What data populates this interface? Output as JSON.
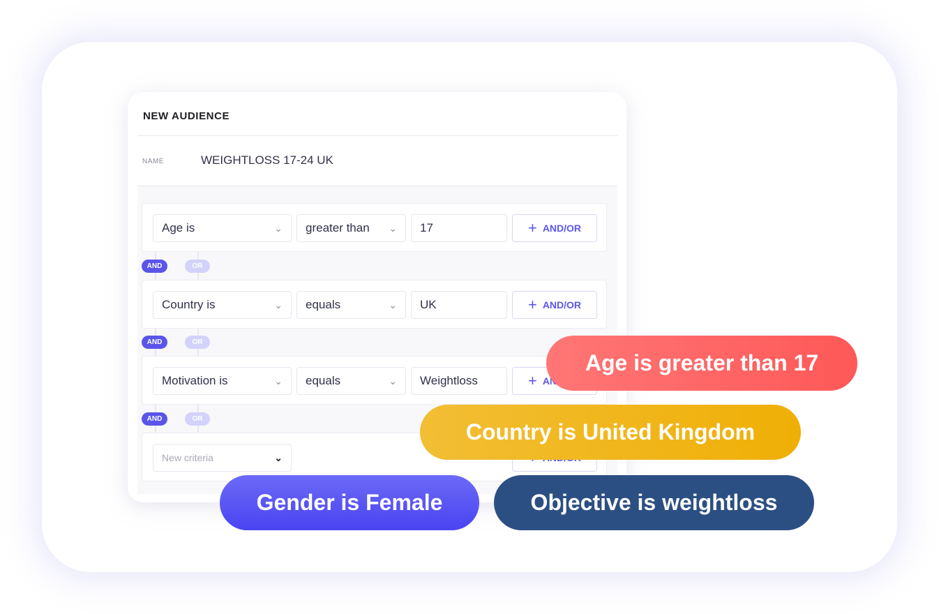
{
  "panel": {
    "title": "NEW AUDIENCE",
    "name_label": "NAME",
    "name_value": "WEIGHTLOSS 17-24 UK"
  },
  "rows": [
    {
      "field": "Age is",
      "operator": "greater than",
      "value": "17",
      "button": "AND/OR"
    },
    {
      "field": "Country is",
      "operator": "equals",
      "value": "UK",
      "button": "AND/OR"
    },
    {
      "field": "Motivation is",
      "operator": "equals",
      "value": "Weightloss",
      "button": "AND/OR"
    },
    {
      "field_placeholder": "New criteria",
      "button": "AND/OR"
    }
  ],
  "connectors": {
    "and": "AND",
    "or": "OR"
  },
  "tags": [
    {
      "label": "Age is greater than 17",
      "color": "#ff5f5f"
    },
    {
      "label": "Country is United Kingdom",
      "color": "#f0b41a"
    },
    {
      "label": "Gender is Female",
      "color": "#5450f3"
    },
    {
      "label": "Objective is weightloss",
      "color": "#2c4f83"
    }
  ]
}
